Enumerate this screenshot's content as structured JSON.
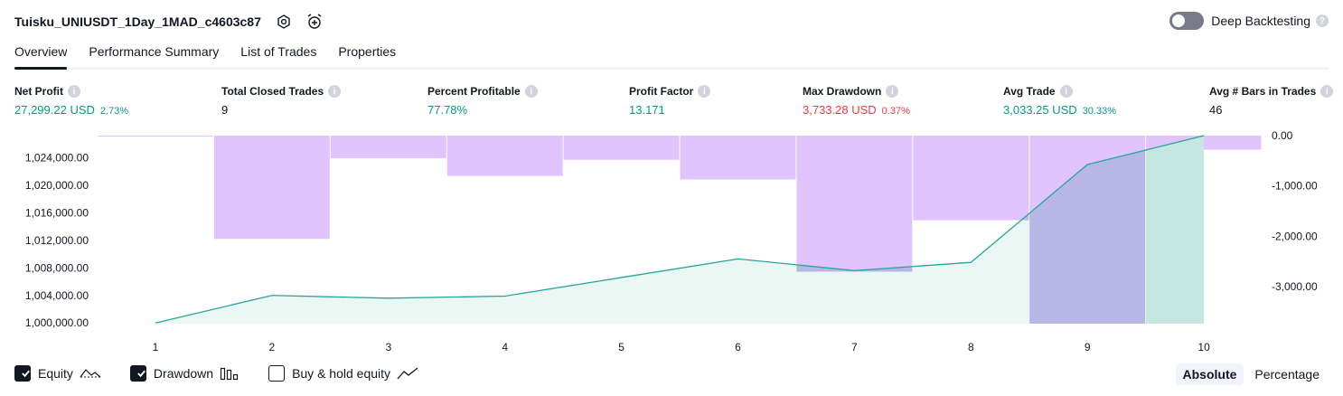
{
  "header": {
    "strategy_name": "Tuisku_UNIUSDT_1Day_1MAD_c4603c87",
    "deep_backtesting_label": "Deep Backtesting",
    "deep_backtesting_on": false
  },
  "tabs": [
    {
      "label": "Overview",
      "active": true
    },
    {
      "label": "Performance Summary",
      "active": false
    },
    {
      "label": "List of Trades",
      "active": false
    },
    {
      "label": "Properties",
      "active": false
    }
  ],
  "metrics": {
    "net_profit": {
      "label": "Net Profit",
      "value": "27,299.22 USD",
      "pct": "2.73%",
      "color": "#089981"
    },
    "total_closed_trades": {
      "label": "Total Closed Trades",
      "value": "9"
    },
    "percent_profitable": {
      "label": "Percent Profitable",
      "value": "77.78%",
      "color": "#089981"
    },
    "profit_factor": {
      "label": "Profit Factor",
      "value": "13.171",
      "color": "#089981"
    },
    "max_drawdown": {
      "label": "Max Drawdown",
      "value": "3,733.28 USD",
      "pct": "0.37%",
      "color": "#f23645"
    },
    "avg_trade": {
      "label": "Avg Trade",
      "value": "3,033.25 USD",
      "pct": "30.33%",
      "color": "#089981"
    },
    "avg_bars": {
      "label": "Avg # Bars in Trades",
      "value": "46"
    }
  },
  "chart_data": {
    "type": "area",
    "x": [
      1,
      2,
      3,
      4,
      5,
      6,
      7,
      8,
      9,
      10
    ],
    "x_ticks": [
      "1",
      "2",
      "3",
      "4",
      "5",
      "6",
      "7",
      "8",
      "9",
      "10"
    ],
    "left_axis": {
      "ticks": [
        "1,000,000.00",
        "1,004,000.00",
        "1,008,000.00",
        "1,012,000.00",
        "1,016,000.00",
        "1,020,000.00",
        "1,024,000.00"
      ],
      "ylim": [
        999900,
        1027200
      ]
    },
    "right_axis": {
      "ticks": [
        "0.00",
        "-1,000.00",
        "-2,000.00",
        "-3,000.00"
      ],
      "ylim": [
        -3733.28,
        0
      ]
    },
    "series": [
      {
        "name": "Equity",
        "kind": "line-area",
        "axis": "left",
        "color": "#26a69a",
        "values": [
          1000000,
          1004000,
          1003600,
          1003900,
          1006600,
          1009300,
          1007600,
          1008800,
          1023000,
          1027200
        ]
      },
      {
        "name": "Drawdown",
        "kind": "bar",
        "axis": "right",
        "values": [
          0,
          -2050,
          -450,
          -800,
          -480,
          -870,
          -2700,
          -1680,
          -3733.28,
          -280
        ]
      }
    ],
    "colors": {
      "equity_line": "#26a69a",
      "equity_fill": "#e3f4ef",
      "drawdown_fill": "#e1c4fd",
      "drawdown_overlap": "#b8b6e6",
      "drawdown_last_fill": "#c6e7e1"
    }
  },
  "legend": [
    {
      "label": "Equity",
      "checked": true,
      "icon": "equity-line-icon"
    },
    {
      "label": "Drawdown",
      "checked": true,
      "icon": "drawdown-bars-icon"
    },
    {
      "label": "Buy & hold equity",
      "checked": false,
      "icon": "buy-hold-line-icon"
    }
  ],
  "view_modes": [
    {
      "label": "Absolute",
      "active": true
    },
    {
      "label": "Percentage",
      "active": false
    }
  ]
}
